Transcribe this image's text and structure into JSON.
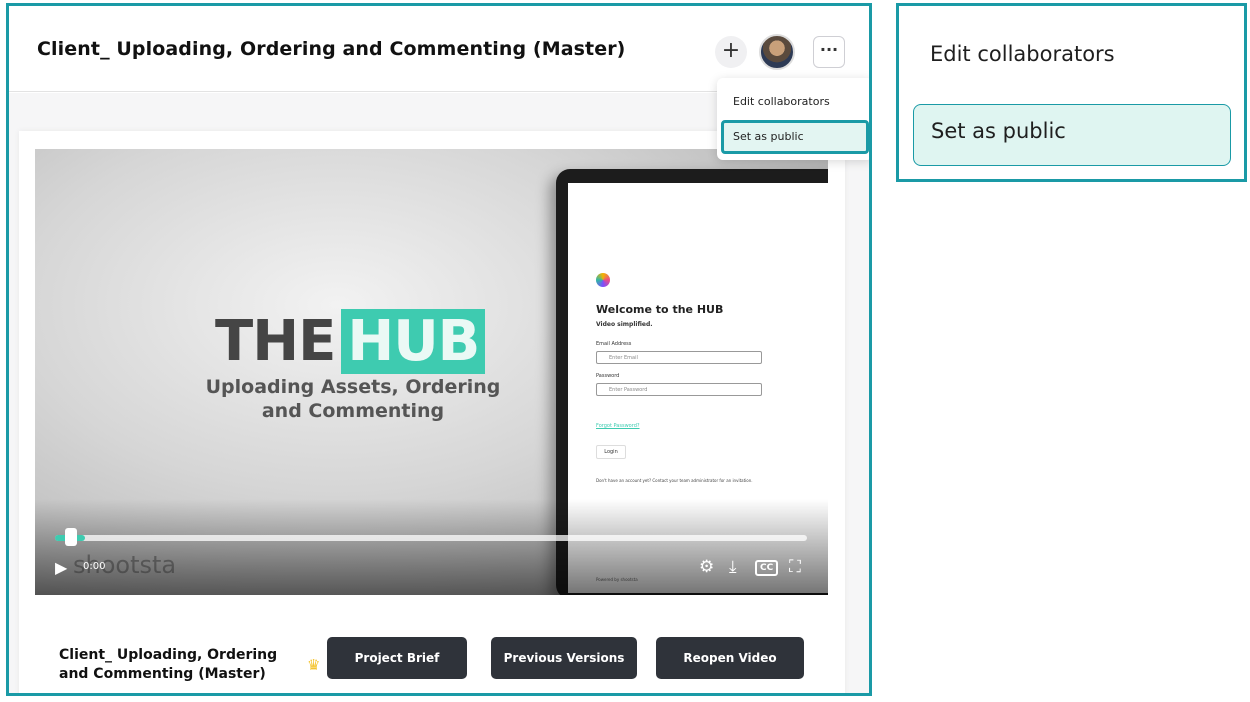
{
  "header": {
    "title": "Client_ Uploading, Ordering and Commenting (Master)",
    "plus_label": "+",
    "more_label": "···"
  },
  "menu": {
    "items": [
      {
        "label": "Edit collaborators"
      },
      {
        "label": "Set as public",
        "highlighted": true
      }
    ]
  },
  "video": {
    "hero_title_part1": "THE",
    "hero_title_part2": "HUB",
    "hero_subtitle": "Uploading Assets, Ordering and Commenting",
    "watermark": "shootsta",
    "time": "0:00",
    "progress": 0.04,
    "screen": {
      "welcome": "Welcome to the HUB",
      "welcome_sub": "Video simplified.",
      "email_label": "Email Address",
      "email_placeholder": "Enter Email",
      "password_label": "Password",
      "password_placeholder": "Enter Password",
      "forgot": "Forgot Password?",
      "login": "Login",
      "no_account": "Don't have an account yet? Contact your team administrator for an invitation.",
      "powered": "Powered by shootsta"
    }
  },
  "footer": {
    "video_title": "Client_ Uploading, Ordering and Commenting (Master)",
    "buttons": {
      "brief": "Project Brief",
      "versions": "Previous Versions",
      "reopen": "Reopen Video"
    }
  },
  "colors": {
    "accent": "#1a9aa6",
    "highlight": "#e3f5f2",
    "teal": "#3ecbb0",
    "dark_button": "#2f333a"
  }
}
